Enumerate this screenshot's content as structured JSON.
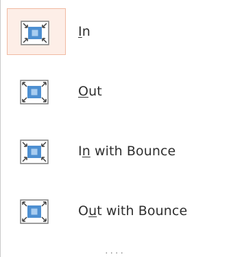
{
  "menu": {
    "items": [
      {
        "name": "In",
        "label_pre": "",
        "label_ul": "I",
        "label_post": "n",
        "icon": "zoom-in-icon",
        "selected": true
      },
      {
        "name": "Out",
        "label_pre": "",
        "label_ul": "O",
        "label_post": "ut",
        "icon": "zoom-out-icon",
        "selected": false
      },
      {
        "name": "In with Bounce",
        "label_pre": "I",
        "label_ul": "n",
        "label_post": " with Bounce",
        "icon": "zoom-in-bounce-icon",
        "selected": false
      },
      {
        "name": "Out with Bounce",
        "label_pre": "O",
        "label_ul": "u",
        "label_post": "t with Bounce",
        "icon": "zoom-out-bounce-icon",
        "selected": false
      }
    ],
    "more": "...."
  },
  "colors": {
    "selected_bg": "#fdeee7",
    "selected_border": "#f1b9a1",
    "icon_blue": "#4d8fd1",
    "icon_light_blue": "#a9cdf0",
    "icon_border": "#8a8a8a"
  }
}
